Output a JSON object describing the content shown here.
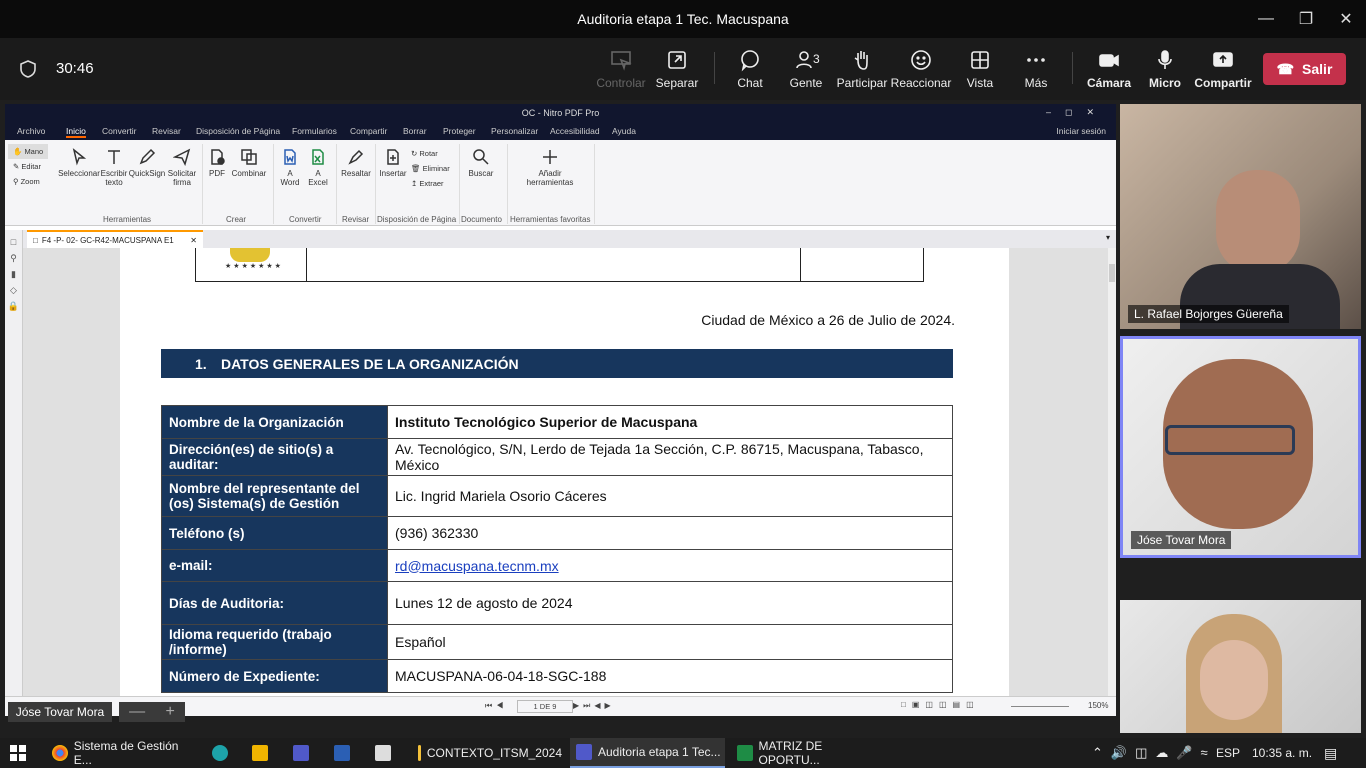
{
  "window": {
    "title": "Auditoria etapa 1 Tec. Macuspana"
  },
  "meeting": {
    "timer": "30:46",
    "buttons": {
      "controlar": "Controlar",
      "separar": "Separar",
      "chat": "Chat",
      "gente": "Gente",
      "gente_count": "3",
      "participar": "Participar",
      "reaccionar": "Reaccionar",
      "vista": "Vista",
      "mas": "Más",
      "camara": "Cámara",
      "micro": "Micro",
      "compartir": "Compartir",
      "salir": "Salir"
    },
    "presenter_chip": "Jóse Tovar Mora",
    "participants": [
      {
        "name": "L. Rafael Bojorges Güereña"
      },
      {
        "name": "Jóse Tovar Mora"
      },
      {
        "name": ""
      }
    ]
  },
  "nitro": {
    "title": "OC - Nitro PDF Pro",
    "menu": [
      "Archivo",
      "Inicio",
      "Convertir",
      "Revisar",
      "Disposición de Página",
      "Formularios",
      "Compartir",
      "Borrar",
      "Proteger",
      "Personalizar",
      "Accesibilidad",
      "Ayuda"
    ],
    "signin": "Iniciar sesión",
    "side_tools": [
      "Mano",
      "Editar",
      "Zoom"
    ],
    "ribbon": {
      "seleccionar": "Seleccionar",
      "escribir_texto": "Escribir texto",
      "quicksign": "QuickSign",
      "solicitar_firma": "Solicitar firma",
      "pdf": "PDF",
      "combinar": "Combinar",
      "a_word": "A Word",
      "a_excel": "A Excel",
      "resaltar": "Resaltar",
      "insertar": "Insertar",
      "rotar": "Rotar",
      "eliminar": "Eliminar",
      "extraer": "Extraer",
      "buscar": "Buscar",
      "anadir": "Añadir herramientas",
      "groups": {
        "herramientas": "Herramientas",
        "crear": "Crear",
        "convertir": "Convertir",
        "revisar": "Revisar",
        "disposicion": "Disposición de Página",
        "documento": "Documento",
        "favoritas": "Herramientas favoritas"
      }
    },
    "tab": "F4 -P- 02- GC-R42-MACUSPANA E1",
    "page_indicator": "1 DE 9",
    "zoom": "150%"
  },
  "document": {
    "date_line": "Ciudad de México a 26 de Julio de 2024.",
    "section_number": "1.",
    "section_title": "DATOS GENERALES DE LA ORGANIZACIÓN",
    "rows": [
      {
        "label": "Nombre de la Organización",
        "value": "Instituto Tecnológico Superior de Macuspana"
      },
      {
        "label": "Dirección(es) de sitio(s) a auditar:",
        "value": "Av. Tecnológico, S/N, Lerdo de Tejada 1a Sección, C.P. 86715, Macuspana, Tabasco, México"
      },
      {
        "label": "Nombre del representante del (os) Sistema(s) de Gestión",
        "value": "Lic. Ingrid Mariela Osorio Cáceres"
      },
      {
        "label": "Teléfono (s)",
        "value": "(936) 362330"
      },
      {
        "label": "e-mail:",
        "value": "rd@macuspana.tecnm.mx"
      },
      {
        "label": "Días de Auditoria:",
        "value": "Lunes 12  de agosto de 2024"
      },
      {
        "label": "Idioma requerido (trabajo /informe)",
        "value": "Español"
      },
      {
        "label": "Número de Expediente:",
        "value": "MACUSPANA-06-04-18-SGC-188"
      }
    ]
  },
  "taskbar": {
    "items": [
      "Sistema de Gestión E...",
      "CONTEXTO_ITSM_2024",
      "Auditoria etapa 1 Tec...",
      "MATRIZ DE OPORTU..."
    ],
    "lang": "ESP",
    "time": "10:35 a. m."
  }
}
